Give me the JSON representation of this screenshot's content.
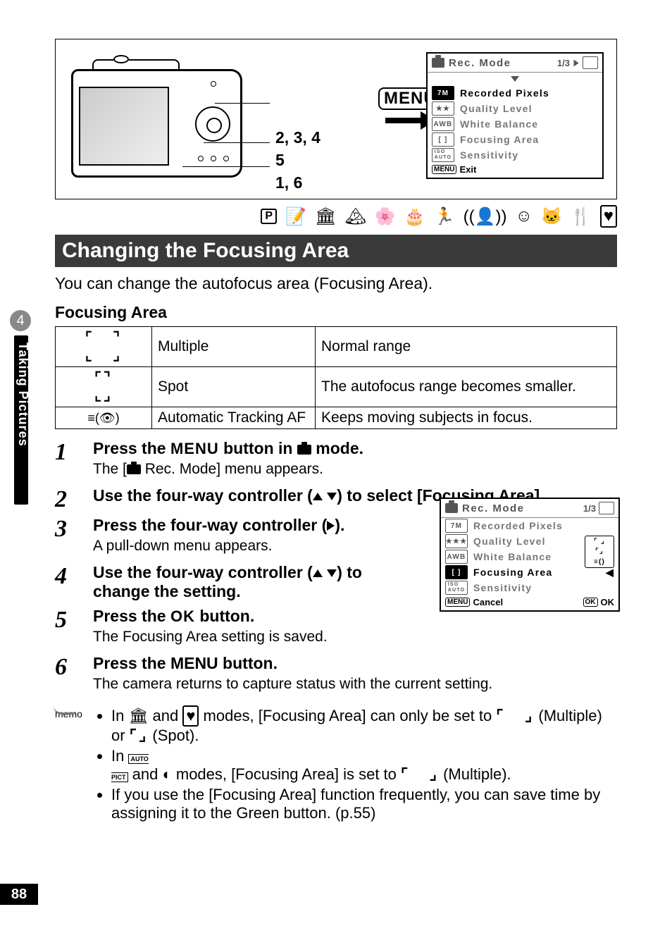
{
  "page_number": "88",
  "side_tab": {
    "chapter": "4",
    "title": "Taking Pictures"
  },
  "diagram": {
    "menu_button": "MENU",
    "step_labels": [
      "2, 3, 4",
      "5",
      "1, 6"
    ]
  },
  "lcd1": {
    "title": "Rec. Mode",
    "page": "1/3",
    "rows": [
      {
        "badge": "7M",
        "label": "Recorded Pixels"
      },
      {
        "badge": "★★",
        "label": "Quality Level"
      },
      {
        "badge": "AWB",
        "label": "White Balance"
      },
      {
        "badge": "[ ]",
        "label": "Focusing Area"
      },
      {
        "badge": "ISO",
        "label": "Sensitivity"
      }
    ],
    "foot_label": "Exit",
    "foot_btn": "MENU"
  },
  "lcd2": {
    "title": "Rec. Mode",
    "page": "1/3",
    "rows": [
      {
        "badge": "7M",
        "label": "Recorded Pixels"
      },
      {
        "badge": "★★★",
        "label": "Quality Level"
      },
      {
        "badge": "AWB",
        "label": "White Balance"
      },
      {
        "badge": "[ ]",
        "label": "Focusing Area"
      },
      {
        "badge": "ISO",
        "label": "Sensitivity"
      }
    ],
    "foot_left_btn": "MENU",
    "foot_left": "Cancel",
    "foot_right_btn": "OK",
    "foot_right": "OK"
  },
  "mode_icons": [
    "P",
    "🅿",
    "▲",
    "🌸",
    "🎂",
    "🏃",
    "((👤))",
    "☺",
    "🐱",
    "🍴",
    "♥"
  ],
  "section_title": "Changing the Focusing Area",
  "intro": "You can change the autofocus area (Focusing Area).",
  "subheading": "Focusing Area",
  "table": {
    "rows": [
      {
        "icon": "[   ]",
        "name": "Multiple",
        "desc": "Normal range"
      },
      {
        "icon": "[ ]",
        "name": "Spot",
        "desc": "The autofocus range becomes smaller."
      },
      {
        "icon": "tracking",
        "name": "Automatic Tracking AF",
        "desc": "Keeps moving subjects in focus."
      }
    ]
  },
  "steps": [
    {
      "n": "1",
      "title_pre": "Press the ",
      "title_menu": "MENU",
      "title_mid": " button in ",
      "title_post": " mode.",
      "desc_pre": "The [",
      "desc_post": " Rec. Mode] menu appears."
    },
    {
      "n": "2",
      "title": "Use the four-way controller (▲▼) to select [Focusing Area]."
    },
    {
      "n": "3",
      "title": "Press the four-way controller (▶).",
      "desc": "A pull-down menu appears."
    },
    {
      "n": "4",
      "title": "Use the four-way controller (▲▼) to change the setting."
    },
    {
      "n": "5",
      "title_pre": "Press the ",
      "title_ok": "OK",
      "title_post": " button.",
      "desc": "The Focusing Area setting is saved."
    },
    {
      "n": "6",
      "title": "Press the MENU button.",
      "desc": "The camera returns to capture status with the current setting."
    }
  ],
  "memo": {
    "label": "memo",
    "items": [
      "In ▲ and ♥ modes, [Focusing Area] can only be set to [   ] (Multiple) or [ ] (Spot).",
      "In AUTO and ☺ modes, [Focusing Area] is set to [   ] (Multiple).",
      "If you use the [Focusing Area] function frequently, you can save time by assigning it to the Green button. (p.55)"
    ]
  }
}
